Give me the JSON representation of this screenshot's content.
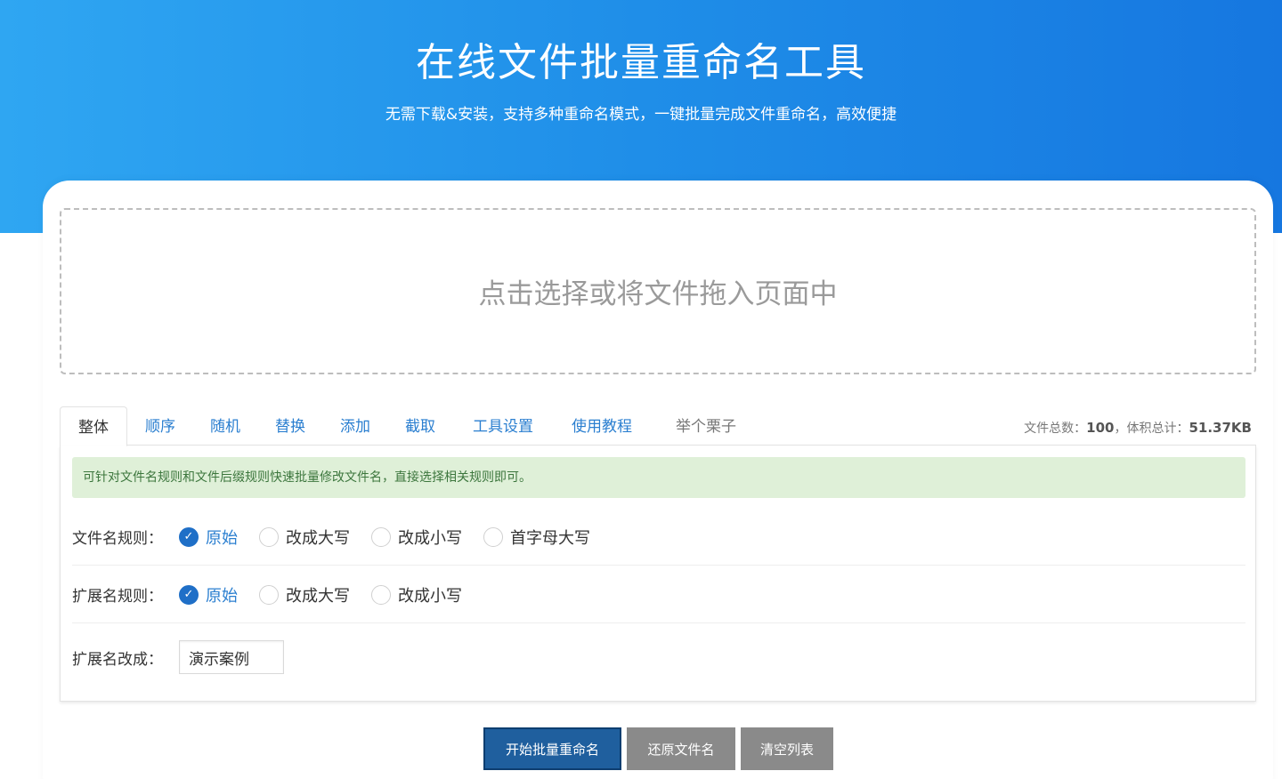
{
  "hero": {
    "title": "在线文件批量重命名工具",
    "subtitle": "无需下载&安装，支持多种重命名模式，一键批量完成文件重命名，高效便捷"
  },
  "dropzone": {
    "text": "点击选择或将文件拖入页面中"
  },
  "tabs": [
    {
      "label": "整体"
    },
    {
      "label": "顺序"
    },
    {
      "label": "随机"
    },
    {
      "label": "替换"
    },
    {
      "label": "添加"
    },
    {
      "label": "截取"
    },
    {
      "label": "工具设置"
    },
    {
      "label": "使用教程"
    },
    {
      "label": "举个栗子"
    }
  ],
  "stats": {
    "count_label": "文件总数：",
    "count_value": "100",
    "sep": "，",
    "size_label": "体积总计：",
    "size_value": "51.37KB"
  },
  "notice": "可针对文件名规则和文件后缀规则快速批量修改文件名，直接选择相关规则即可。",
  "filename_rule": {
    "label": "文件名规则：",
    "options": [
      "原始",
      "改成大写",
      "改成小写",
      "首字母大写"
    ],
    "selected": "原始"
  },
  "ext_rule": {
    "label": "扩展名规则：",
    "options": [
      "原始",
      "改成大写",
      "改成小写"
    ],
    "selected": "原始"
  },
  "ext_change": {
    "label": "扩展名改成：",
    "value": "演示案例"
  },
  "buttons": {
    "start": "开始批量重命名",
    "restore": "还原文件名",
    "clear": "清空列表"
  },
  "colors": {
    "hero_start": "#2fa6f2",
    "hero_end": "#1677e0",
    "tab_link": "#2b7fd0",
    "primary_button": "#1f5f9e",
    "gray_button": "#8a8a8a",
    "notice_bg": "#dff0d8"
  },
  "icons": {
    "radio_checked": "check-icon"
  }
}
